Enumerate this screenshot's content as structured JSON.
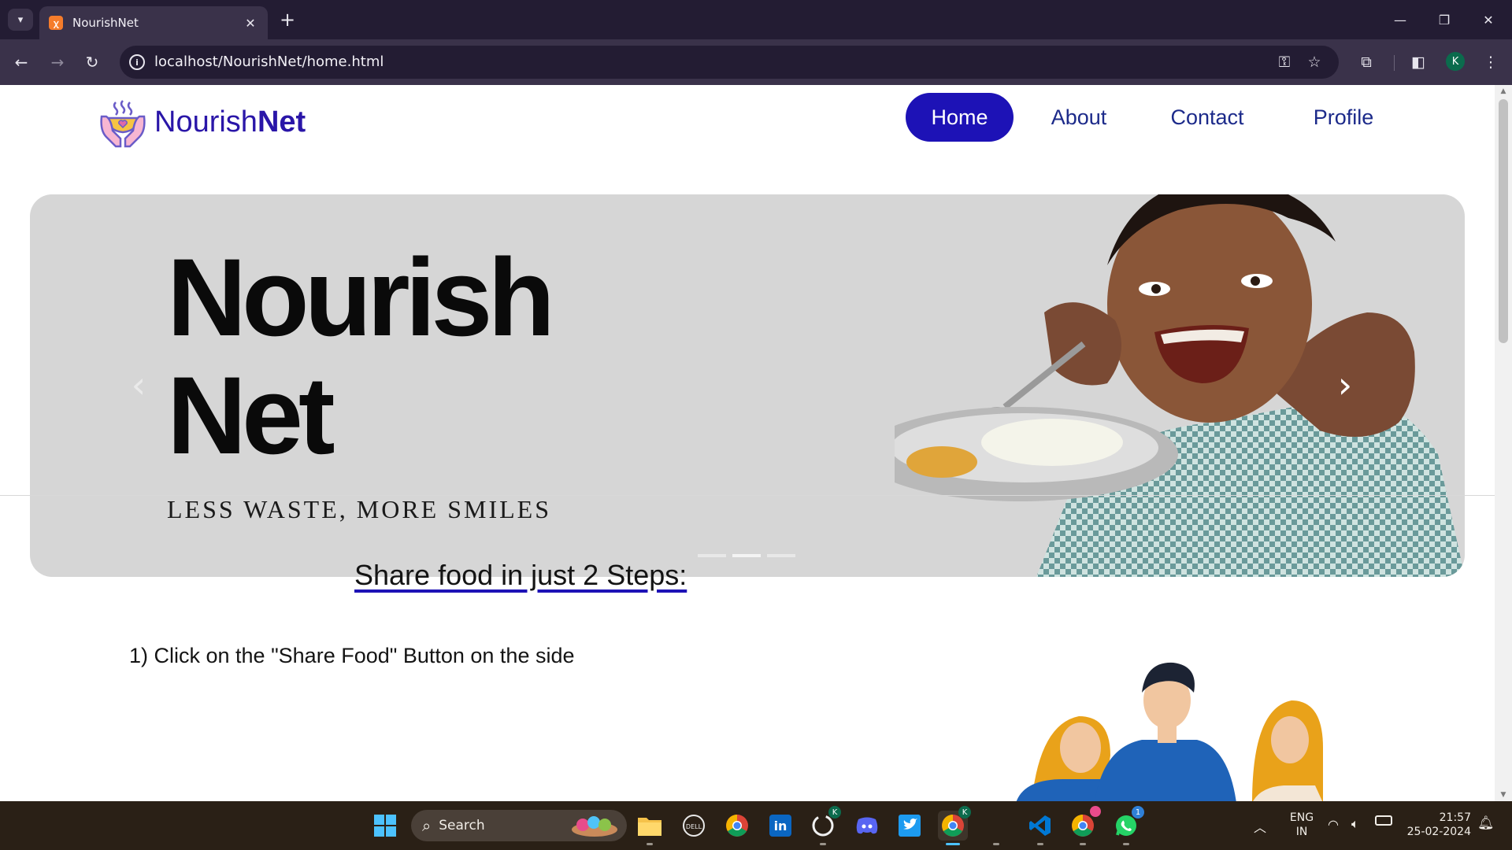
{
  "browser": {
    "tab_title": "NourishNet",
    "tab_favicon_icon": "xampp-icon",
    "url": "localhost/NourishNet/home.html",
    "profile_initial": "K"
  },
  "site": {
    "brand_regular": "Nourish",
    "brand_bold": "Net",
    "nav": [
      {
        "label": "Home",
        "active": true
      },
      {
        "label": "About",
        "active": false
      },
      {
        "label": "Contact",
        "active": false
      },
      {
        "label": "Profile",
        "active": false
      }
    ],
    "hero": {
      "title_line1": "Nourish",
      "title_line2": "Net",
      "tagline": "LESS WASTE, MORE SMILES",
      "slides_total": 3,
      "active_slide": 2
    },
    "steps_title": "Share food in just 2 Steps:",
    "step_1": "1) Click on the \"Share Food\" Button on the side"
  },
  "taskbar": {
    "search_label": "Search",
    "language_line1": "ENG",
    "language_line2": "IN",
    "time": "21:57",
    "date": "25-02-2024",
    "github_badge": "K",
    "chrome_badge": "K",
    "whatsapp_badge": "1"
  },
  "colors": {
    "brand": "#2a16a8",
    "nav_active_bg": "#1d12b6",
    "nav_text": "#1c2a8a",
    "hero_bg": "#d6d6d6",
    "titlebar": "#231c33",
    "toolbar": "#3a324a"
  }
}
